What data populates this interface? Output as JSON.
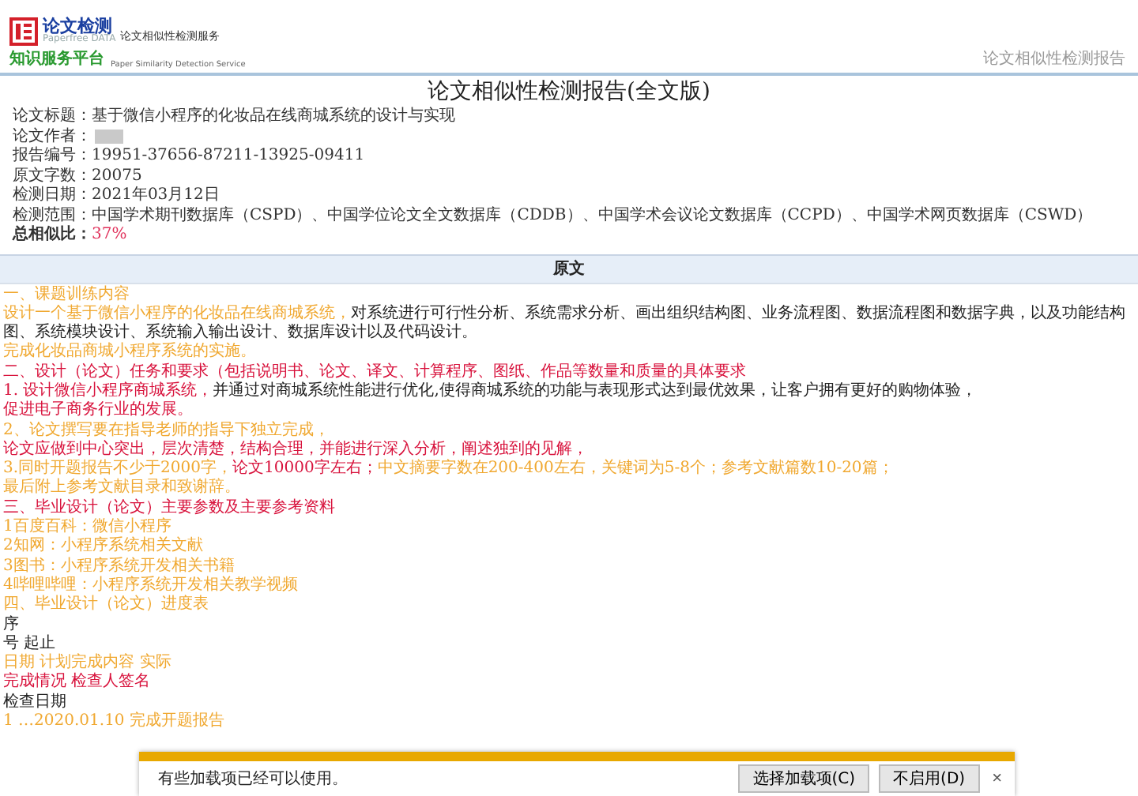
{
  "header": {
    "logo_title": "论文检测",
    "logo_subtitle": "Paperfree DATA",
    "logo_tagline": "知识服务平台",
    "service_name": "论文相似性检测服务",
    "service_name_en": "Paper Similarity Detection Service",
    "page_label": "论文相似性检测报告"
  },
  "report": {
    "title": "论文相似性检测报告(全文版)",
    "fields": [
      {
        "label": "论文标题：",
        "value": "基于微信小程序的化妆品在线商城系统的设计与实现"
      },
      {
        "label": "论文作者：",
        "redacted": true
      },
      {
        "label": "报告编号：",
        "value": "19951-37656-87211-13925-09411"
      },
      {
        "label": "原文字数：",
        "value": "20075"
      },
      {
        "label": "检测日期：",
        "value": "2021年03月12日"
      },
      {
        "label": "检测范围：",
        "value": "中国学术期刊数据库（CSPD）、中国学位论文全文数据库（CDDB）、中国学术会议论文数据库（CCPD）、中国学术网页数据库（CSWD）"
      }
    ],
    "total_label": "总相似比：",
    "total_value": "37%"
  },
  "original": {
    "heading": "原文",
    "lines": [
      [
        {
          "text": "一、课题训练内容",
          "color": "#f0a830"
        }
      ],
      [
        {
          "text": "设计一个基于微信小程序的化妆品在线商城系统，",
          "color": "#f0a830"
        },
        {
          "text": "对系统进行可行性分析、系统需求分析、画出组织结构图、业务流程图、数据流程图和数据字典，以及功能结构图、系统模块设计、系统输入输出设计、数据库设计以及代码设计。",
          "color": "#222222"
        }
      ],
      [
        {
          "text": "完成化妆品商城小程序系统的实施。",
          "color": "#f0a830"
        }
      ],
      [
        {
          "text": "二、设计（论文）任务和要求（包括说明书、论文、译文、计算程序、图纸、作品等数量和质量的具体要求",
          "color": "#d8123c"
        }
      ],
      [
        {
          "text": "1. 设计微信小程序商城系统，",
          "color": "#d8123c"
        },
        {
          "text": "并通过对商城系统性能进行优化,使得商城系统的功能与表现形式达到最优效果，让客户拥有更好的购物体验，",
          "color": "#222222"
        }
      ],
      [
        {
          "text": "促进电子商务行业的发展。",
          "color": "#d8123c"
        }
      ],
      [
        {
          "text": "2、论文撰写要在指导老师的指导下独立完成，",
          "color": "#f0a830"
        }
      ],
      [
        {
          "text": "论文应做到中心突出，层次清楚，结构合理，并能进行深入分析，阐述独到的见解，",
          "color": "#d8123c"
        }
      ],
      [
        {
          "text": "3.同时开题报告不少于2000字，",
          "color": "#f0a830"
        },
        {
          "text": "论文10000字左右；",
          "color": "#d8123c"
        },
        {
          "text": "中文摘要字数在200-400左右，关键词为5-8个；参考文献篇数10-20篇；",
          "color": "#f0a830"
        }
      ],
      [
        {
          "text": "最后附上参考文献目录和致谢辞。",
          "color": "#f0a830"
        }
      ],
      [
        {
          "text": "三、毕业设计（论文）主要参数及主要参考资料",
          "color": "#d8123c"
        }
      ],
      [
        {
          "text": "1百度百科：微信小程序",
          "color": "#f0a830"
        }
      ],
      [
        {
          "text": "2知网：小程序系统相关文献",
          "color": "#f0a830"
        }
      ],
      [
        {
          "text": "3图书：小程序系统开发相关书籍",
          "color": "#f0a830"
        }
      ],
      [
        {
          "text": "4哔哩哔哩：小程序系统开发相关教学视频",
          "color": "#f0a830"
        }
      ],
      [
        {
          "text": "四、毕业设计（论文）进度表",
          "color": "#f0a830"
        }
      ],
      [
        {
          "text": "序",
          "color": "#222222"
        }
      ],
      [
        {
          "text": "号 起止",
          "color": "#222222"
        }
      ],
      [
        {
          "text": "日期 计划完成内容 实际",
          "color": "#f0a830"
        }
      ],
      [
        {
          "text": "完成情况 检查人签名",
          "color": "#d8123c"
        }
      ],
      [
        {
          "text": "检查日期",
          "color": "#222222"
        }
      ],
      [
        {
          "text": "1 …2020.01.10 完成开题报告",
          "color": "#f0a830"
        }
      ]
    ]
  },
  "notification": {
    "message": "有些加载项已经可以使用。",
    "buttons": [
      "选择加载项(C)",
      "不启用(D)"
    ],
    "close": "×"
  }
}
